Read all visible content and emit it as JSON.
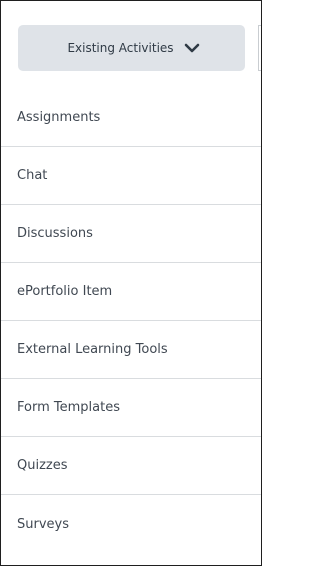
{
  "toolbar": {
    "button_label": "Existing Activities",
    "button_icon": "chevron-down-icon"
  },
  "menu": {
    "items": [
      "Assignments",
      "Chat",
      "Discussions",
      "ePortfolio Item",
      "External Learning Tools",
      "Form Templates",
      "Quizzes",
      "Surveys"
    ]
  },
  "colors": {
    "button_background": "#dfe3e8",
    "text": "#404852",
    "divider": "#d9dcdf"
  }
}
